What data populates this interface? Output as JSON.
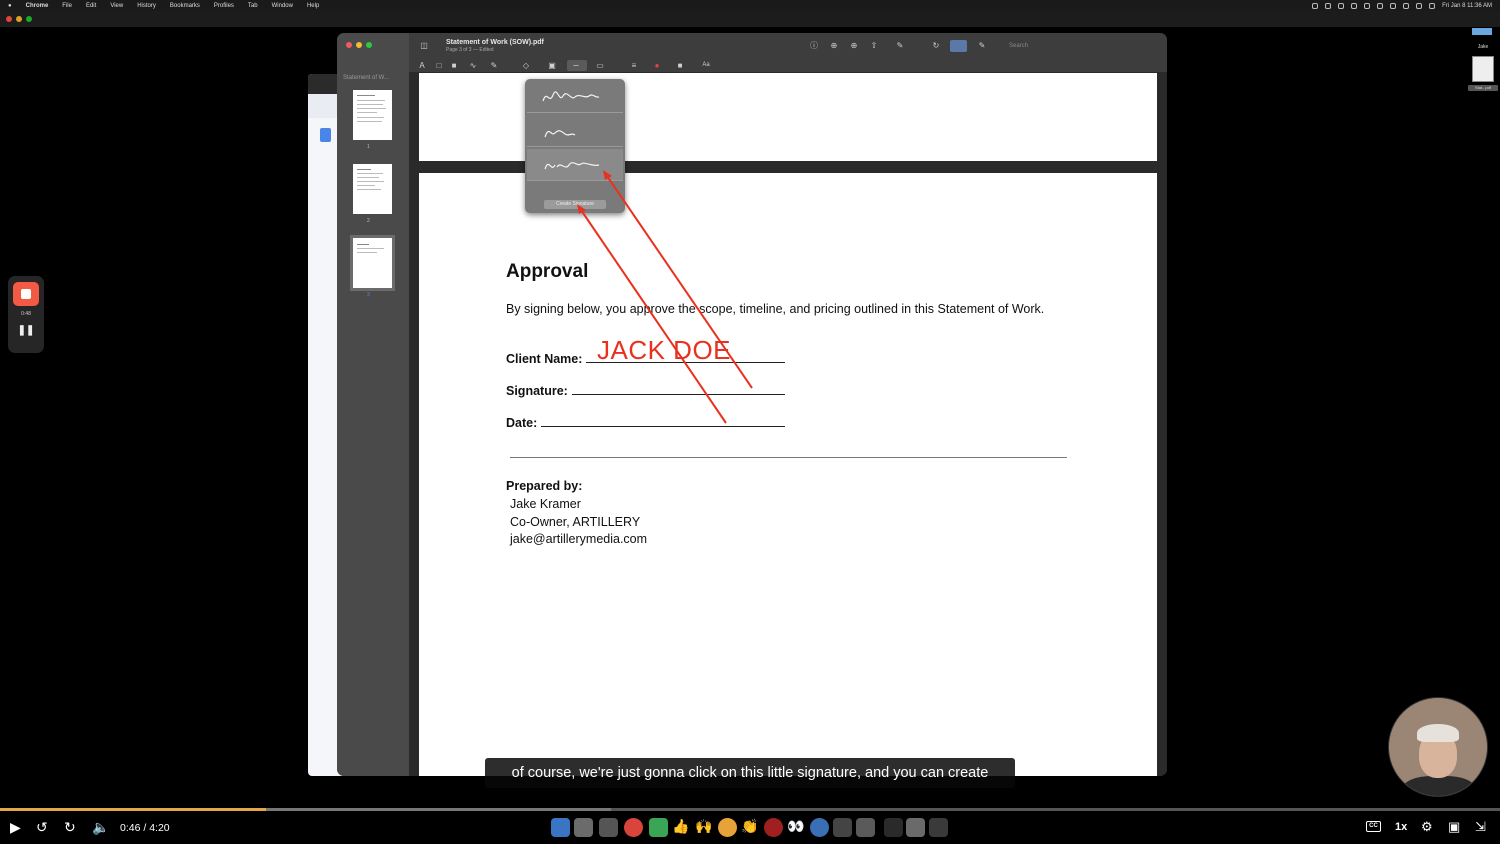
{
  "menubar": {
    "items": [
      "Chrome",
      "File",
      "Edit",
      "View",
      "History",
      "Bookmarks",
      "Profiles",
      "Tab",
      "Window",
      "Help"
    ],
    "clock": "Fri Jan 8  11:36 AM"
  },
  "preview": {
    "title": "Statement of Work (SOW).pdf",
    "subtitle": "Page 3 of 3 — Edited",
    "sidebar_title": "Statement of W...",
    "thumbnails": [
      {
        "number": "1"
      },
      {
        "number": "2"
      },
      {
        "number": "3"
      }
    ],
    "search_placeholder": "Search",
    "signature_menu": {
      "create_label": "Create Signature"
    }
  },
  "document": {
    "heading": "Approval",
    "paragraph": "By signing below, you approve the scope, timeline, and pricing outlined in this Statement of Work.",
    "client_name_label": "Client Name:",
    "client_name_value": "JACK DOE",
    "signature_label": "Signature:",
    "date_label": "Date:",
    "prepared_by_label": "Prepared by:",
    "prepared_lines": [
      "Jake Kramer",
      "Co-Owner, ARTILLERY",
      "jake@artillerymedia.com"
    ]
  },
  "recording": {
    "elapsed": "0:48"
  },
  "right_panel": {
    "user_name": "Jake",
    "file_label": "Stat...pdf"
  },
  "caption": "of course, we're just gonna click on this little signature, and you can create",
  "player": {
    "time": "0:46 / 4:20",
    "progress": 0.177,
    "speed": "1x",
    "cc_label": "CC"
  },
  "colors": {
    "annotation_red": "#e8311f",
    "progress": "#e3a64a",
    "record": "#f25a45"
  }
}
